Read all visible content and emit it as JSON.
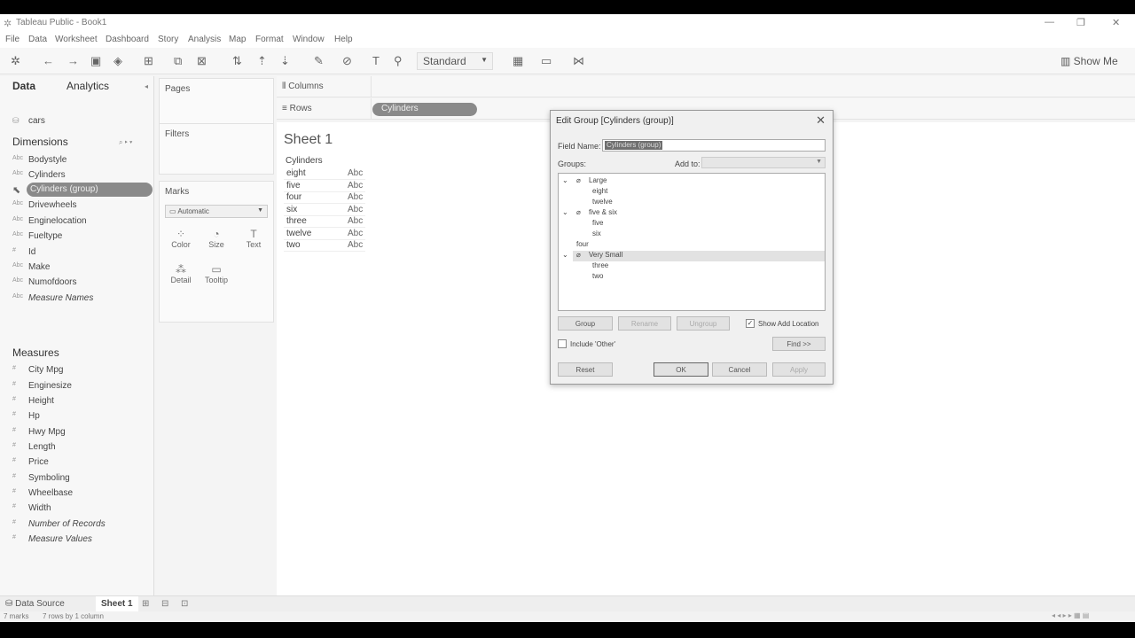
{
  "window": {
    "title": "Tableau Public - Book1",
    "controls": [
      "—",
      "❐",
      "✕"
    ]
  },
  "menu": [
    "File",
    "Data",
    "Worksheet",
    "Dashboard",
    "Story",
    "Analysis",
    "Map",
    "Format",
    "Window",
    "Help"
  ],
  "toolbar": {
    "fit_select": "Standard",
    "show_me": "Show Me"
  },
  "data_pane": {
    "tab_data": "Data",
    "tab_analytics": "Analytics",
    "source": "cars",
    "dimensions_title": "Dimensions",
    "dimensions": [
      {
        "type": "Abc",
        "label": "Bodystyle"
      },
      {
        "type": "Abc",
        "label": "Cylinders"
      },
      {
        "type": "Abc",
        "label": "Cylinders (group)"
      },
      {
        "type": "Abc",
        "label": "Drivewheels"
      },
      {
        "type": "Abc",
        "label": "Enginelocation"
      },
      {
        "type": "Abc",
        "label": "Fueltype"
      },
      {
        "type": "#",
        "label": "Id"
      },
      {
        "type": "Abc",
        "label": "Make"
      },
      {
        "type": "Abc",
        "label": "Numofdoors"
      },
      {
        "type": "Abc",
        "label": "Measure Names"
      }
    ],
    "measures_title": "Measures",
    "measures": [
      {
        "type": "#",
        "label": "City Mpg"
      },
      {
        "type": "#",
        "label": "Enginesize"
      },
      {
        "type": "#",
        "label": "Height"
      },
      {
        "type": "#",
        "label": "Hp"
      },
      {
        "type": "#",
        "label": "Hwy Mpg"
      },
      {
        "type": "#",
        "label": "Length"
      },
      {
        "type": "#",
        "label": "Price"
      },
      {
        "type": "#",
        "label": "Symboling"
      },
      {
        "type": "#",
        "label": "Wheelbase"
      },
      {
        "type": "#",
        "label": "Width"
      },
      {
        "type": "#",
        "label": "Number of Records"
      },
      {
        "type": "#",
        "label": "Measure Values"
      }
    ]
  },
  "cards": {
    "pages": "Pages",
    "filters": "Filters",
    "marks": "Marks",
    "mark_type": "Automatic",
    "color": "Color",
    "size": "Size",
    "text": "Text",
    "detail": "Detail",
    "tooltip": "Tooltip"
  },
  "shelves": {
    "columns": "Columns",
    "rows": "Rows",
    "rows_pill": "Cylinders"
  },
  "view": {
    "sheet_title": "Sheet 1",
    "header": "Cylinders",
    "rows": [
      {
        "label": "eight",
        "value": "Abc"
      },
      {
        "label": "five",
        "value": "Abc"
      },
      {
        "label": "four",
        "value": "Abc"
      },
      {
        "label": "six",
        "value": "Abc"
      },
      {
        "label": "three",
        "value": "Abc"
      },
      {
        "label": "twelve",
        "value": "Abc"
      },
      {
        "label": "two",
        "value": "Abc"
      }
    ]
  },
  "dialog": {
    "title": "Edit Group [Cylinders (group)]",
    "field_name_label": "Field Name:",
    "field_name_value": "Cylinders (group)",
    "groups_label": "Groups:",
    "add_to_label": "Add to:",
    "tree": {
      "g1": "Large",
      "g1a": "eight",
      "g1b": "twelve",
      "g2": "five & six",
      "g2a": "five",
      "g2b": "six",
      "loose": "four",
      "g3": "Very Small",
      "g3a": "three",
      "g3b": "two"
    },
    "btn_group": "Group",
    "btn_rename": "Rename",
    "btn_ungroup": "Ungroup",
    "show_add_location": "Show Add Location",
    "include_other": "Include 'Other'",
    "btn_find": "Find >>",
    "btn_reset": "Reset",
    "btn_ok": "OK",
    "btn_cancel": "Cancel",
    "btn_apply": "Apply"
  },
  "tabs": {
    "data_source": "Data Source",
    "sheet1": "Sheet 1"
  },
  "status": {
    "marks": "7 marks",
    "dims": "7 rows by 1 column"
  }
}
